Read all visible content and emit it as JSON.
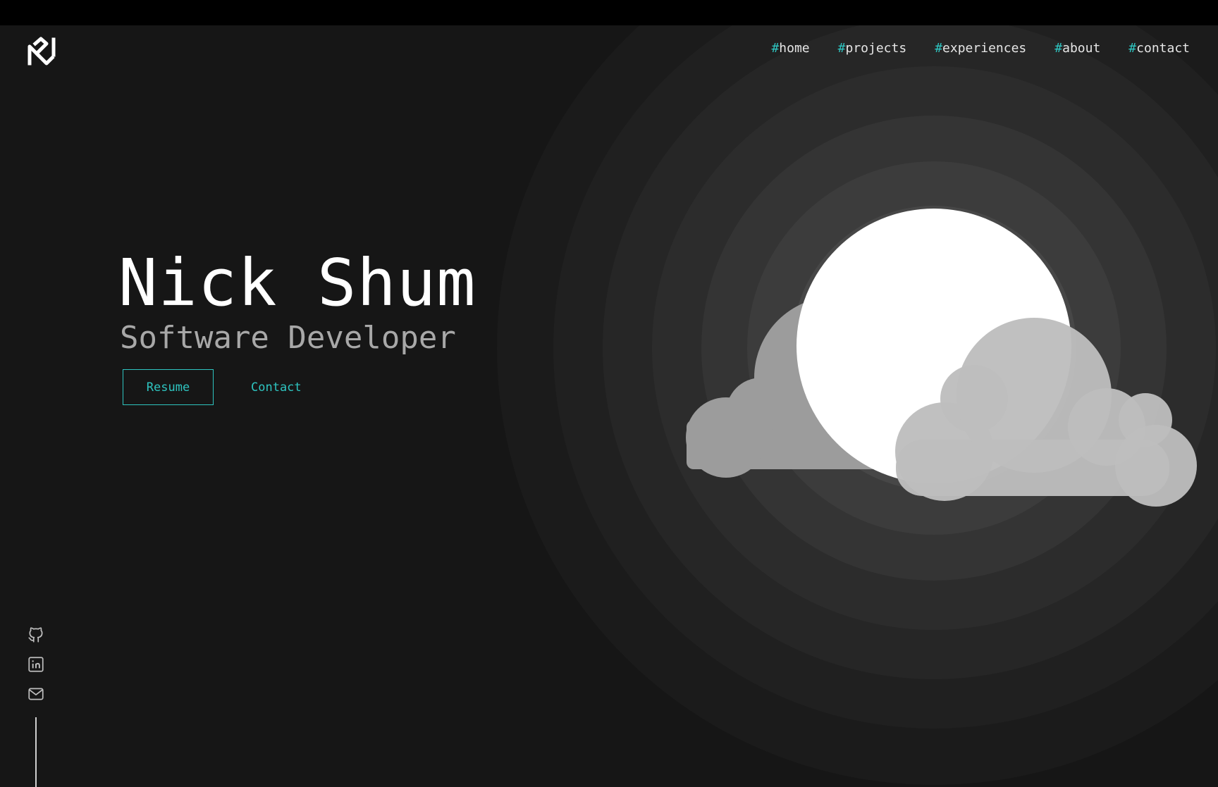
{
  "nav": {
    "items": [
      {
        "hash": "#",
        "label": "home"
      },
      {
        "hash": "#",
        "label": "projects"
      },
      {
        "hash": "#",
        "label": "experiences"
      },
      {
        "hash": "#",
        "label": "about"
      },
      {
        "hash": "#",
        "label": "contact"
      }
    ]
  },
  "hero": {
    "name": "Nick Shum",
    "role": "Software Developer",
    "resume_label": "Resume",
    "contact_label": "Contact"
  },
  "social": {
    "icons": [
      "github-icon",
      "linkedin-icon",
      "mail-icon"
    ]
  },
  "colors": {
    "background": "#161616",
    "accent": "#2ec4c0",
    "text": "#ffffff",
    "muted": "#a8a8a8"
  }
}
